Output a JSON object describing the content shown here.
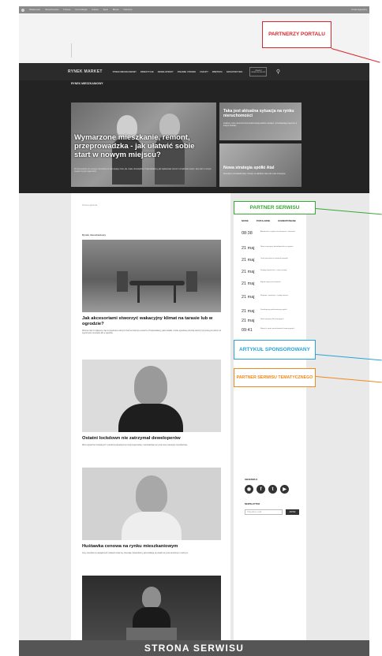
{
  "topbar": {
    "items": [
      "Wiadomości",
      "Nieruchomości",
      "Finanse",
      "Komunikacja",
      "Kultura",
      "Sport",
      "Biznes",
      "Partnerzy"
    ],
    "right": "Portal regionalny"
  },
  "callouts": {
    "portal_partners": "PARTNERZY PORTALU",
    "site_partner": "PARTNER SERWISU",
    "sponsored": "ARTYKUŁ SPONSOROWANY",
    "theme_partner": "PARTNER SERWISU TEMATYCZNEGO"
  },
  "colors": {
    "red": "#d9262c",
    "green": "#3aa935",
    "blue": "#29a3d8",
    "orange": "#f08a1c",
    "footer": "#555555"
  },
  "nav": {
    "logo": "RYNEK MARKET",
    "items": [
      "RYNEK MIESZKANIOWY",
      "INWESTYCJE",
      "DEWELOPERZY",
      "FINANSE I PRAWO",
      "ZAKUPY",
      "WNĘTRZA",
      "ARCHITEKTURA"
    ],
    "button": "ZNAJDŹ NIERUCHOMOŚĆ",
    "search_icon": "search-icon"
  },
  "hero": {
    "breadcrumb": "RYNEK MIESZKANIOWY",
    "main_title": "Wymarzone mieszkanie, remont, przeprowadzka - jak ułatwić sobie start w nowym miejscu?",
    "main_desc": "Przeprowadzka do nowego mieszkania to ekscytujący czas, ale i wiele obowiązków. Podpowiadamy, jak zaplanować remont i urządzanie wnętrz, aby start w nowym miejscu był jak najprostszy.",
    "card1_title": "Taka jest aktualna sytuacja na rynku nieruchomości",
    "card1_desc": "Analitycy rynku nieruchomości podsumowują ostatnie miesiące i przedstawiają prognozy na kolejne kwartały.",
    "card2_title": "Nowa strategia spółki Atal",
    "card2_desc": "Deweloper przedstawił plany rozwoju na najbliższe lata oraz nowe inwestycje."
  },
  "main": {
    "breadcrumb": "Strona główna",
    "section_label": "Rynek mieszkaniowy",
    "articles": [
      {
        "title": "Jak akcesoriami stworzyć wakacyjny klimat na tarasie lub w ogrodzie?",
        "desc": "Wiosna i lato to najlepszy czas na spędzanie wolnych chwil na świeżym powietrzu. Podpowiadamy, jakie dodatki i meble ogrodowe pozwolą stworzyć przytulną przestrzeń do wypoczynku na tarasie lub w ogrodzie."
      },
      {
        "title": "Ostatni lockdown nie zatrzymał deweloperów",
        "desc": "Mimo ograniczeń związanych z pandemią deweloperzy kontynuują budowy i wprowadzają na rynek nowe inwestycje mieszkaniowe."
      },
      {
        "title": "Huśtawka cenowa na rynku mieszkaniowym",
        "desc": "Ceny mieszkań w największych miastach wciąż się zmieniają. Sprawdzamy, jak kształtują się stawki na rynku pierwotnym i wtórnym."
      },
      {
        "title": "",
        "desc": ""
      }
    ]
  },
  "sidebar": {
    "tabs": [
      "NOWE",
      "POPULARNE",
      "KOMENTOWANE"
    ],
    "news": [
      {
        "time": "08:38",
        "text": "Aktualności z rynku nieruchomości i finansów"
      },
      {
        "time": "21 maj",
        "text": "Nowe inwestycje deweloperskie w regionie"
      },
      {
        "time": "21 maj",
        "text": "Ceny mieszkań w ostatnim kwartale"
      },
      {
        "time": "21 maj",
        "text": "Kredyty hipoteczne - nowe zasady"
      },
      {
        "time": "21 maj",
        "text": "Rynek najmu po zmianach"
      },
      {
        "time": "21 maj",
        "text": "Wnętrza i aranżacje - trendy sezonu"
      },
      {
        "time": "21 maj",
        "text": "Deweloperzy podsumowują wyniki"
      },
      {
        "time": "21 maj",
        "text": "Nowe przepisy dla kupujących"
      },
      {
        "time": "09:41",
        "text": "Raport z rynku nieruchomości komercyjnych"
      }
    ],
    "social_label": "OBSERWUJ",
    "social_icons": [
      "instagram-icon",
      "facebook-icon",
      "twitter-icon",
      "youtube-icon"
    ],
    "newsletter_label": "NEWSLETTER",
    "newsletter_placeholder": "Twój adres e-mail",
    "newsletter_button": "ZAPISZ"
  },
  "footer_label": "STRONA SERWISU"
}
